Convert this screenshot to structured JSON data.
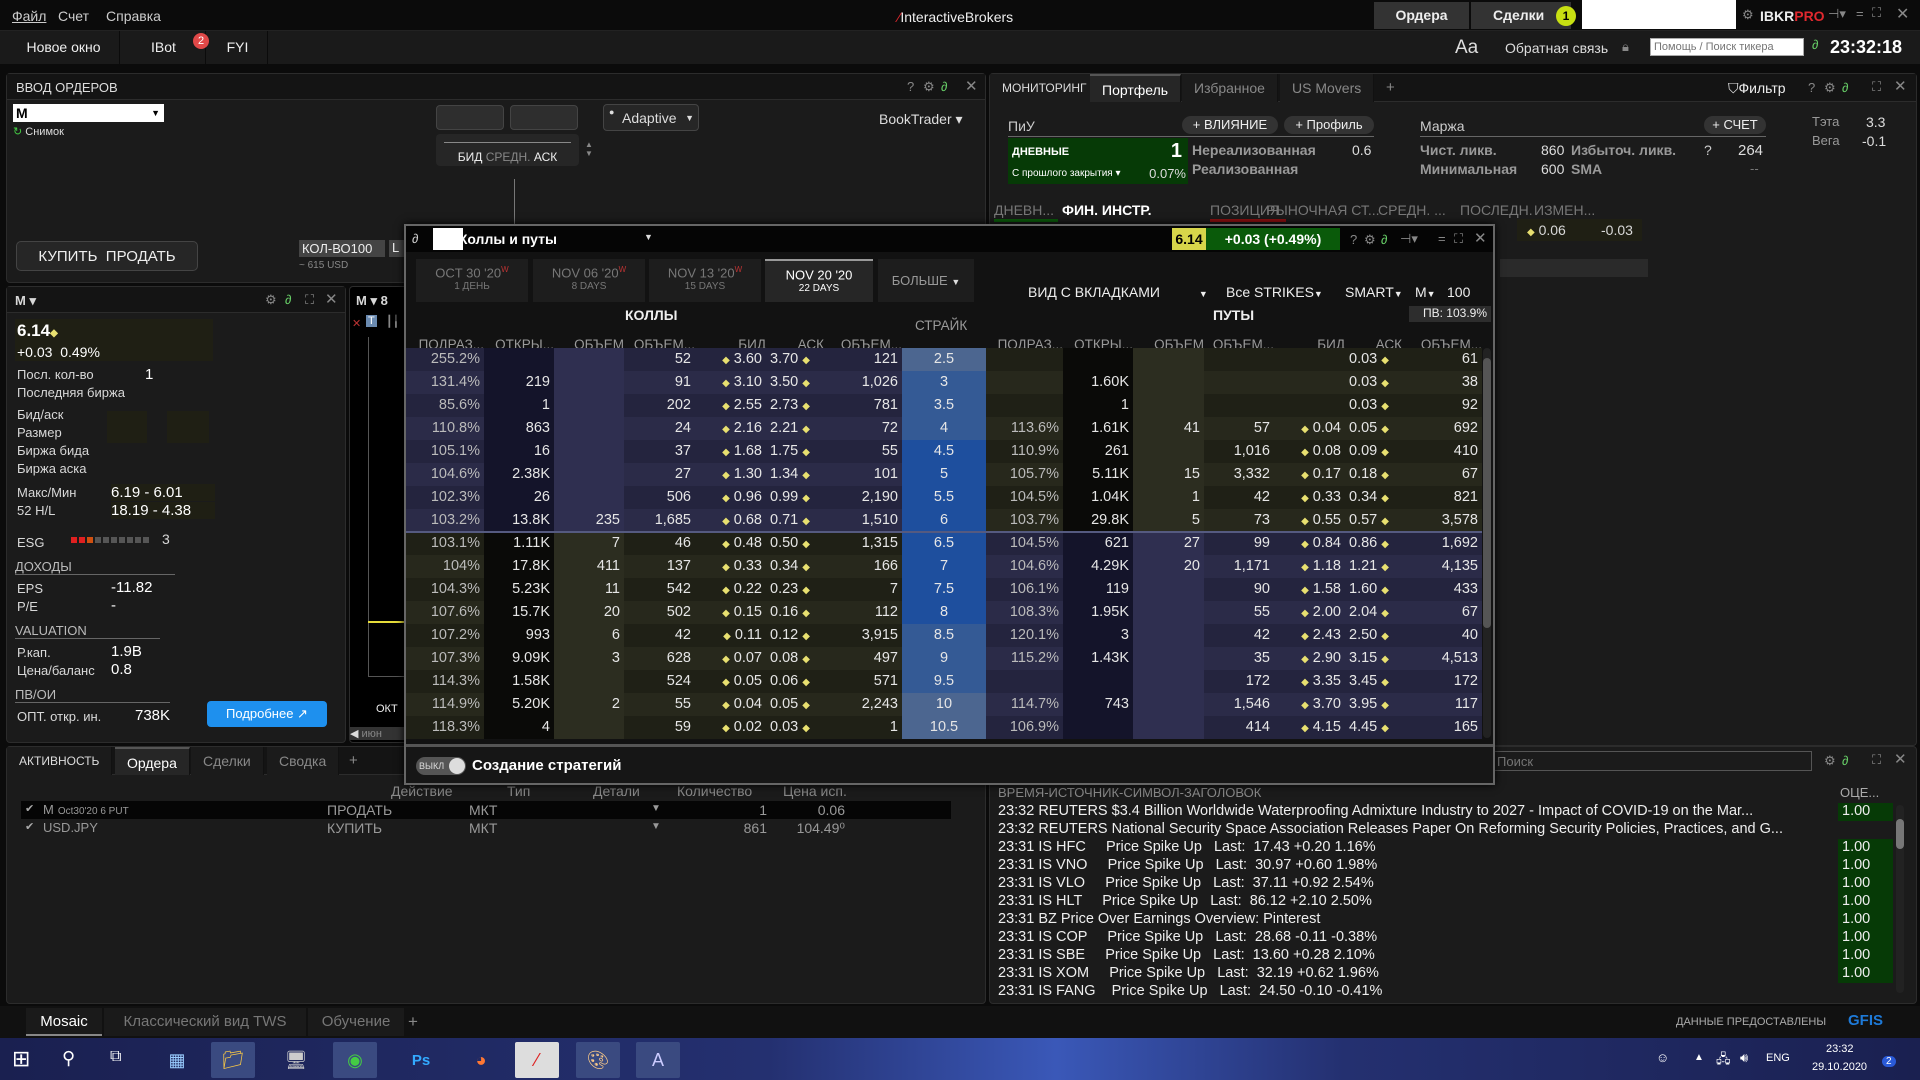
{
  "menu": [
    "Файл",
    "Счет",
    "Справка"
  ],
  "brand": "InteractiveBrokers",
  "top_buttons": {
    "orders": "Ордера",
    "trades": "Сделки",
    "trades_badge": "1",
    "ibkr": "IBKR",
    "pro": "PRO"
  },
  "toolbar": {
    "new_window": "Новое окно",
    "ibot": "IBot",
    "ibot_badge": "2",
    "fyi": "FYI",
    "font": "Aa",
    "feedback": "Обратная связь",
    "search_placeholder": "Помощь / Поиск тикера",
    "clock": "23:32:18"
  },
  "order_entry": {
    "title": "ВВОД ОРДЕРОВ",
    "symbol": "M",
    "snapshot": "Снимок",
    "bid": "БИД",
    "mid": "СРЕДН.",
    "ask": "АСК",
    "algo": "Adaptive",
    "booktrader": "BookTrader",
    "buy": "КУПИТЬ",
    "sell": "ПРОДАТЬ",
    "qty_label": "КОЛ-ВО",
    "qty": "100",
    "lmt": "L",
    "approx": "~ 615 USD"
  },
  "quote": {
    "symbol": "M",
    "last": "6.14",
    "change": "+0.03",
    "change_pct": "0.49%",
    "rows": [
      [
        "Посл. кол-во",
        "1"
      ],
      [
        "Последняя биржа",
        ""
      ],
      [
        "Бид/аск",
        ""
      ],
      [
        "Размер",
        ""
      ],
      [
        "Биржа бида",
        ""
      ],
      [
        "Биржа аска",
        ""
      ],
      [
        "Макс/Мин",
        "6.19 - 6.01"
      ],
      [
        "52 H/L",
        "18.19 - 4.38"
      ]
    ],
    "esg_label": "ESG",
    "esg_value": "3",
    "esg_level": 3,
    "income_title": "ДОХОДЫ",
    "eps_label": "EPS",
    "eps": "-11.82",
    "pe_label": "P/E",
    "pe": "-",
    "valuation_title": "VALUATION",
    "mcap_label": "Р.кап.",
    "mcap": "1.9B",
    "pb_label": "Цена/баланс",
    "pb": "0.8",
    "ivoi_title": "ПВ/ОИ",
    "oi_label": "ОПТ. откр. ин.",
    "oi": "738K",
    "more": "Подробнее ↗"
  },
  "chart": {
    "symbol": "M",
    "period": "8",
    "month1": "ОКТ",
    "month2": "июн"
  },
  "chain": {
    "title": "Коллы и путы",
    "price": "6.14",
    "change": "+0.03 (+0.49%)",
    "expiries": [
      {
        "date": "OCT 30 '20",
        "w": "W",
        "days": "1 ДЕНЬ"
      },
      {
        "date": "NOV 06 '20",
        "w": "W",
        "days": "8 DAYS"
      },
      {
        "date": "NOV 13 '20",
        "w": "W",
        "days": "15 DAYS"
      },
      {
        "date": "NOV 20 '20",
        "w": "",
        "days": "22 DAYS",
        "selected": true
      }
    ],
    "more": "БОЛЬШЕ",
    "view": "ВИД С ВКЛАДКАМИ",
    "strikes": "Все STRIKES",
    "exchange": "SMART",
    "sym": "M",
    "mult": "100",
    "iv": "ПВ: 103.9%",
    "calls_label": "КОЛЛЫ",
    "puts_label": "ПУТЫ",
    "strike_label": "СТРАЙК",
    "columns": [
      "ПОДРАЗ...",
      "ОТКРЫ...",
      "ОБЪЕМ",
      "ОБЪЕМ...",
      "БИД",
      "АСК",
      "ОБЪЕМ..."
    ],
    "underlying": 6.14,
    "rows": [
      {
        "strike": "2.5",
        "c": [
          "255.2%",
          "",
          "",
          "52",
          "3.60",
          "3.70",
          "121"
        ],
        "p": [
          "",
          "",
          "",
          "",
          "",
          "0.03",
          "61"
        ]
      },
      {
        "strike": "3",
        "c": [
          "131.4%",
          "219",
          "",
          "91",
          "3.10",
          "3.50",
          "1,026"
        ],
        "p": [
          "",
          "1.60K",
          "",
          "",
          "",
          "0.03",
          "38"
        ]
      },
      {
        "strike": "3.5",
        "c": [
          "85.6%",
          "1",
          "",
          "202",
          "2.55",
          "2.73",
          "781"
        ],
        "p": [
          "",
          "1",
          "",
          "",
          "",
          "0.03",
          "92"
        ]
      },
      {
        "strike": "4",
        "c": [
          "110.8%",
          "863",
          "",
          "24",
          "2.16",
          "2.21",
          "72"
        ],
        "p": [
          "113.6%",
          "1.61K",
          "41",
          "57",
          "0.04",
          "0.05",
          "692"
        ]
      },
      {
        "strike": "4.5",
        "c": [
          "105.1%",
          "16",
          "",
          "37",
          "1.68",
          "1.75",
          "55"
        ],
        "p": [
          "110.9%",
          "261",
          "",
          "1,016",
          "0.08",
          "0.09",
          "410"
        ]
      },
      {
        "strike": "5",
        "c": [
          "104.6%",
          "2.38K",
          "",
          "27",
          "1.30",
          "1.34",
          "101"
        ],
        "p": [
          "105.7%",
          "5.11K",
          "15",
          "3,332",
          "0.17",
          "0.18",
          "67"
        ]
      },
      {
        "strike": "5.5",
        "c": [
          "102.3%",
          "26",
          "",
          "506",
          "0.96",
          "0.99",
          "2,190"
        ],
        "p": [
          "104.5%",
          "1.04K",
          "1",
          "42",
          "0.33",
          "0.34",
          "821"
        ]
      },
      {
        "strike": "6",
        "c": [
          "103.2%",
          "13.8K",
          "235",
          "1,685",
          "0.68",
          "0.71",
          "1,510"
        ],
        "p": [
          "103.7%",
          "29.8K",
          "5",
          "73",
          "0.55",
          "0.57",
          "3,578"
        ]
      },
      {
        "strike": "6.5",
        "c": [
          "103.1%",
          "1.11K",
          "7",
          "46",
          "0.48",
          "0.50",
          "1,315"
        ],
        "p": [
          "104.5%",
          "621",
          "27",
          "99",
          "0.84",
          "0.86",
          "1,692"
        ]
      },
      {
        "strike": "7",
        "c": [
          "104%",
          "17.8K",
          "411",
          "137",
          "0.33",
          "0.34",
          "166"
        ],
        "p": [
          "104.6%",
          "4.29K",
          "20",
          "1,171",
          "1.18",
          "1.21",
          "4,135"
        ]
      },
      {
        "strike": "7.5",
        "c": [
          "104.3%",
          "5.23K",
          "11",
          "542",
          "0.22",
          "0.23",
          "7"
        ],
        "p": [
          "106.1%",
          "119",
          "",
          "90",
          "1.58",
          "1.60",
          "433"
        ]
      },
      {
        "strike": "8",
        "c": [
          "107.6%",
          "15.7K",
          "20",
          "502",
          "0.15",
          "0.16",
          "112"
        ],
        "p": [
          "108.3%",
          "1.95K",
          "",
          "55",
          "2.00",
          "2.04",
          "67"
        ]
      },
      {
        "strike": "8.5",
        "c": [
          "107.2%",
          "993",
          "6",
          "42",
          "0.11",
          "0.12",
          "3,915"
        ],
        "p": [
          "120.1%",
          "3",
          "",
          "42",
          "2.43",
          "2.50",
          "40"
        ]
      },
      {
        "strike": "9",
        "c": [
          "107.3%",
          "9.09K",
          "3",
          "628",
          "0.07",
          "0.08",
          "497"
        ],
        "p": [
          "115.2%",
          "1.43K",
          "",
          "35",
          "2.90",
          "3.15",
          "4,513"
        ]
      },
      {
        "strike": "9.5",
        "c": [
          "114.3%",
          "1.58K",
          "",
          "524",
          "0.05",
          "0.06",
          "571"
        ],
        "p": [
          "",
          "",
          "",
          "172",
          "3.35",
          "3.45",
          "172"
        ]
      },
      {
        "strike": "10",
        "c": [
          "114.9%",
          "5.20K",
          "2",
          "55",
          "0.04",
          "0.05",
          "2,243"
        ],
        "p": [
          "114.7%",
          "743",
          "",
          "1,546",
          "3.70",
          "3.95",
          "117"
        ]
      },
      {
        "strike": "10.5",
        "c": [
          "118.3%",
          "4",
          "",
          "59",
          "0.02",
          "0.03",
          "1"
        ],
        "p": [
          "106.9%",
          "",
          "",
          "414",
          "4.15",
          "4.45",
          "165"
        ]
      }
    ],
    "toggle": "ВЫКЛ",
    "strategy": "Создание стратегий"
  },
  "portfolio": {
    "tabs": [
      "МОНИТОРИНГ",
      "Портфель",
      "Избранное",
      "US Movers"
    ],
    "filter": "Фильтр",
    "pnl": "ПиУ",
    "impact": "+ ВЛИЯНИЕ",
    "profile": "+ Профиль",
    "daily": "ДНЕВНЫЕ",
    "daily_val": "1",
    "since_close": "С прошлого закрытия ▾",
    "since_close_val": "0.07%",
    "unrealized": "Нереализованная",
    "unrealized_val": "0.6",
    "realized": "Реализованная",
    "margin": "Маржа",
    "account": "+ СЧЕТ",
    "net_liq": "Чист. ликв.",
    "net_liq_val": "860",
    "excess": "Избыточ. ликв.",
    "excess_q": "?",
    "excess_val": "264",
    "maint": "Минимальная",
    "maint_val": "600",
    "sma": "SMA",
    "sma_val": "--",
    "theta": "Тэта",
    "theta_val": "3.3",
    "vega": "Вега",
    "vega_val": "-0.1",
    "columns": [
      "ДНЕВН...",
      "ФИН. ИНСТР.",
      "ПОЗИЦИЯ",
      "РЫНОЧНАЯ СТ...",
      "СРЕДН. ...",
      "ПОСЛЕДН.",
      "ИЗМЕН..."
    ],
    "row": {
      "last": "0.06",
      "change": "-0.03"
    }
  },
  "activity": {
    "tabs": [
      "АКТИВНОСТЬ",
      "Ордера",
      "Сделки",
      "Сводка"
    ],
    "columns": [
      "Действие",
      "Тип",
      "Детали",
      "Количество",
      "Цена исп."
    ],
    "rows": [
      {
        "inst": "M",
        "inst_detail": "Oct30'20 6 PUT",
        "action": "ПРОДАТЬ",
        "type": "МКТ",
        "qty": "1",
        "price": "0.06"
      },
      {
        "inst": "USD.JPY",
        "inst_detail": "",
        "action": "КУПИТЬ",
        "type": "МКТ",
        "qty": "861",
        "price": "104.49⁰"
      }
    ]
  },
  "news": {
    "search_placeholder": "Поиск",
    "header": "ВРЕМЯ-ИСТОЧНИК-СИМВОЛ-ЗАГОЛОВОК",
    "rank_header": "ОЦЕ...",
    "items": [
      {
        "text": "23:32 REUTERS $3.4 Billion Worldwide Waterproofing Admixture Industry to 2027 - Impact of COVID-19 on the Mar...",
        "rank": "1.00"
      },
      {
        "text": "23:32 REUTERS National Security Space Association Releases Paper On Reforming Security Policies, Practices, and G...",
        "rank": ""
      },
      {
        "text": "23:31 IS HFC     Price Spike Up   Last:  17.43 +0.20 1.16%",
        "rank": "1.00"
      },
      {
        "text": "23:31 IS VNO     Price Spike Up   Last:  30.97 +0.60 1.98%",
        "rank": "1.00"
      },
      {
        "text": "23:31 IS VLO     Price Spike Up   Last:  37.11 +0.92 2.54%",
        "rank": "1.00"
      },
      {
        "text": "23:31 IS HLT     Price Spike Up   Last:  86.12 +2.10 2.50%",
        "rank": "1.00"
      },
      {
        "text": "23:31 BZ Price Over Earnings Overview: Pinterest",
        "rank": "1.00"
      },
      {
        "text": "23:31 IS COP     Price Spike Up   Last:  28.68 -0.11 -0.38%",
        "rank": "1.00"
      },
      {
        "text": "23:31 IS SBE     Price Spike Up   Last:  13.60 +0.28 2.10%",
        "rank": "1.00"
      },
      {
        "text": "23:31 IS XOM     Price Spike Up   Last:  32.19 +0.62 1.96%",
        "rank": "1.00"
      },
      {
        "text": "23:31 IS FANG    Price Spike Up   Last:  24.50 -0.10 -0.41%",
        "rank": ""
      }
    ]
  },
  "layouts": {
    "tabs": [
      "Mosaic",
      "Классический вид TWS",
      "Обучение"
    ],
    "data_by": "ДАННЫЕ ПРЕДОСТАВЛЕНЫ",
    "gfis": "GFIS"
  },
  "taskbar": {
    "lang": "ENG",
    "time": "23:32",
    "date": "29.10.2020",
    "notif": "2"
  },
  "colors": {
    "green_bg": "#063a06",
    "price_yellow": "#d7d64a",
    "change_green": "#0a5a0a",
    "accent_blue": "#1e90ff",
    "ibkr_red": "#e0282e"
  }
}
